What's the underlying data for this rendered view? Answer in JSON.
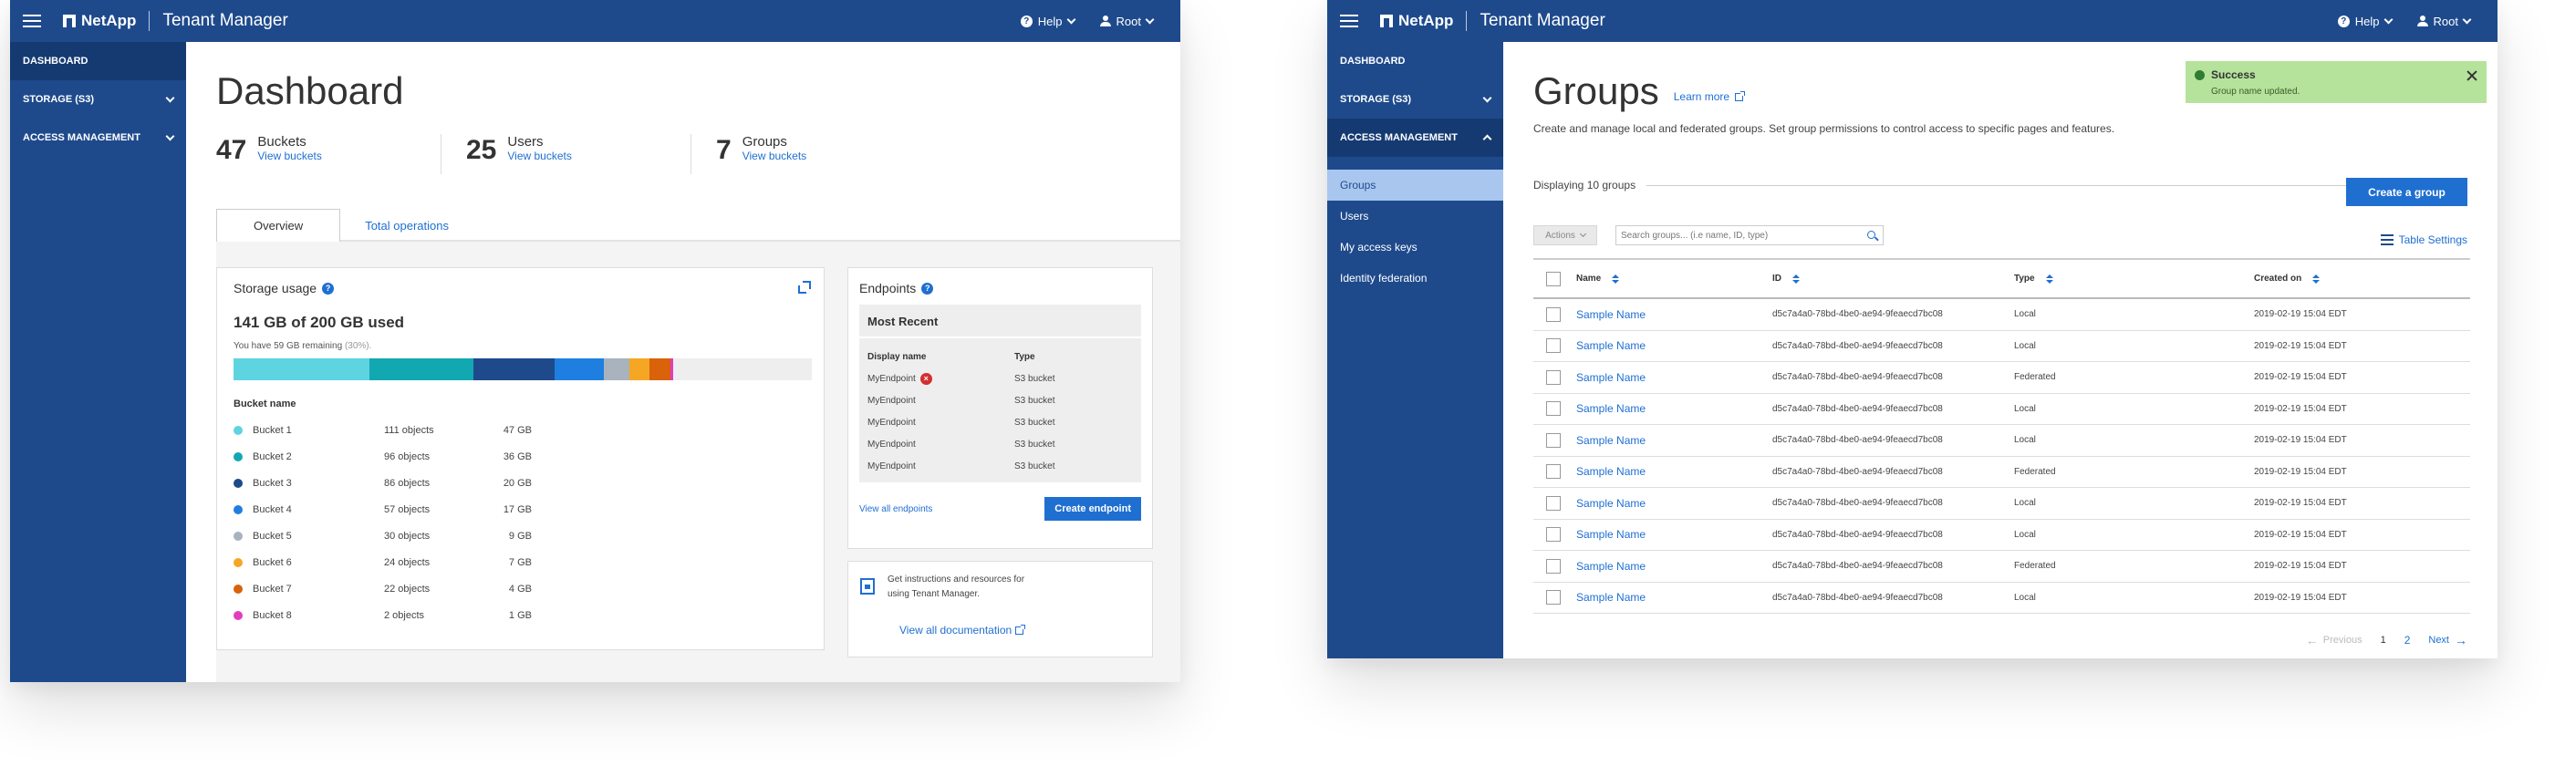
{
  "header": {
    "brand": "NetApp",
    "product": "Tenant Manager",
    "help_label": "Help",
    "user_label": "Root",
    "color": "#1e4a8c"
  },
  "sidebar1": {
    "items": [
      {
        "label": "DASHBOARD"
      },
      {
        "label": "STORAGE (S3)"
      },
      {
        "label": "ACCESS MANAGEMENT"
      }
    ]
  },
  "dashboard": {
    "title": "Dashboard",
    "stats": [
      {
        "value": "47",
        "label": "Buckets",
        "link": "View buckets"
      },
      {
        "value": "25",
        "label": "Users",
        "link": "View buckets"
      },
      {
        "value": "7",
        "label": "Groups",
        "link": "View buckets"
      }
    ],
    "tabs": [
      {
        "label": "Overview"
      },
      {
        "label": "Total operations"
      }
    ],
    "storage": {
      "title": "Storage usage",
      "used": "141 GB of 200 GB used",
      "remaining": "You have 59 GB remaining",
      "remaining_pct": "(30%).",
      "bucket_header": "Bucket name",
      "buckets": [
        {
          "name": "Bucket 1",
          "objects": "111 objects",
          "size": "47 GB",
          "color": "#5dd4e0",
          "gb": 47
        },
        {
          "name": "Bucket 2",
          "objects": "96 objects",
          "size": "36 GB",
          "color": "#12a8b2",
          "gb": 36
        },
        {
          "name": "Bucket 3",
          "objects": "86 objects",
          "size": "20 GB",
          "color": "#1e4a8c",
          "gb": 28
        },
        {
          "name": "Bucket 4",
          "objects": "57 objects",
          "size": "17 GB",
          "color": "#1f7fe0",
          "gb": 17
        },
        {
          "name": "Bucket 5",
          "objects": "30 objects",
          "size": "9 GB",
          "color": "#a9b3bd",
          "gb": 9
        },
        {
          "name": "Bucket 6",
          "objects": "24 objects",
          "size": "7 GB",
          "color": "#f5a623",
          "gb": 7
        },
        {
          "name": "Bucket 7",
          "objects": "22 objects",
          "size": "4 GB",
          "color": "#d9620a",
          "gb": 7
        },
        {
          "name": "Bucket 8",
          "objects": "2 objects",
          "size": "1 GB",
          "color": "#e23dbe",
          "gb": 1
        }
      ],
      "total_gb": 200
    },
    "endpoints": {
      "title": "Endpoints",
      "subtitle": "Most Recent",
      "col_name": "Display name",
      "col_type": "Type",
      "rows": [
        {
          "name": "MyEndpoint",
          "type": "S3 bucket",
          "error": true
        },
        {
          "name": "MyEndpoint",
          "type": "S3 bucket",
          "error": false
        },
        {
          "name": "MyEndpoint",
          "type": "S3 bucket",
          "error": false
        },
        {
          "name": "MyEndpoint",
          "type": "S3 bucket",
          "error": false
        },
        {
          "name": "MyEndpoint",
          "type": "S3 bucket",
          "error": false
        }
      ],
      "view_all": "View all endpoints",
      "create": "Create endpoint"
    },
    "docs": {
      "text": "Get instructions and resources for using Tenant Manager.",
      "link": "View all documentation"
    }
  },
  "sidebar2": {
    "items": [
      {
        "label": "DASHBOARD"
      },
      {
        "label": "STORAGE (S3)"
      },
      {
        "label": "ACCESS MANAGEMENT"
      }
    ],
    "sub": [
      {
        "label": "Groups"
      },
      {
        "label": "Users"
      },
      {
        "label": "My access keys"
      },
      {
        "label": "Identity federation"
      }
    ]
  },
  "groups": {
    "title": "Groups",
    "learn_more": "Learn more",
    "description": "Create and manage local and federated groups. Set group permissions to control access to specific pages and features.",
    "displaying": "Displaying 10 groups",
    "create": "Create a group",
    "actions": "Actions",
    "search_placeholder": "Search groups... (i.e name, ID, type)",
    "table_settings": "Table Settings",
    "columns": {
      "name": "Name",
      "id": "ID",
      "type": "Type",
      "created": "Created on"
    },
    "rows": [
      {
        "name": "Sample Name",
        "id": "d5c7a4a0-78bd-4be0-ae94-9feaecd7bc08",
        "type": "Local",
        "created": "2019-02-19 15:04 EDT"
      },
      {
        "name": "Sample Name",
        "id": "d5c7a4a0-78bd-4be0-ae94-9feaecd7bc08",
        "type": "Local",
        "created": "2019-02-19 15:04 EDT"
      },
      {
        "name": "Sample Name",
        "id": "d5c7a4a0-78bd-4be0-ae94-9feaecd7bc08",
        "type": "Federated",
        "created": "2019-02-19 15:04 EDT"
      },
      {
        "name": "Sample Name",
        "id": "d5c7a4a0-78bd-4be0-ae94-9feaecd7bc08",
        "type": "Local",
        "created": "2019-02-19 15:04 EDT"
      },
      {
        "name": "Sample Name",
        "id": "d5c7a4a0-78bd-4be0-ae94-9feaecd7bc08",
        "type": "Local",
        "created": "2019-02-19 15:04 EDT"
      },
      {
        "name": "Sample Name",
        "id": "d5c7a4a0-78bd-4be0-ae94-9feaecd7bc08",
        "type": "Federated",
        "created": "2019-02-19 15:04 EDT"
      },
      {
        "name": "Sample Name",
        "id": "d5c7a4a0-78bd-4be0-ae94-9feaecd7bc08",
        "type": "Local",
        "created": "2019-02-19 15:04 EDT"
      },
      {
        "name": "Sample Name",
        "id": "d5c7a4a0-78bd-4be0-ae94-9feaecd7bc08",
        "type": "Local",
        "created": "2019-02-19 15:04 EDT"
      },
      {
        "name": "Sample Name",
        "id": "d5c7a4a0-78bd-4be0-ae94-9feaecd7bc08",
        "type": "Federated",
        "created": "2019-02-19 15:04 EDT"
      },
      {
        "name": "Sample Name",
        "id": "d5c7a4a0-78bd-4be0-ae94-9feaecd7bc08",
        "type": "Local",
        "created": "2019-02-19 15:04 EDT"
      }
    ],
    "pager": {
      "prev": "Previous",
      "page1": "1",
      "page2": "2",
      "next": "Next"
    },
    "toast": {
      "title": "Success",
      "message": "Group name updated."
    }
  }
}
